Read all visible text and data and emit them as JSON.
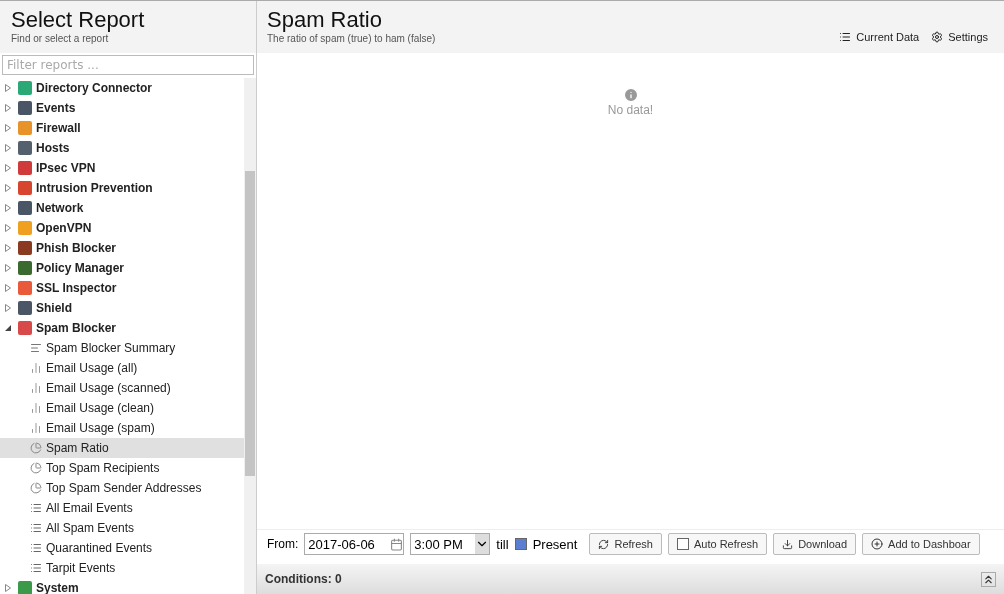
{
  "sidebar": {
    "title": "Select Report",
    "subtitle": "Find or select a report",
    "filter": {
      "placeholder": "Filter reports ..."
    },
    "tree": [
      {
        "label": "Directory Connector",
        "color": "#2aa876",
        "expanded": false
      },
      {
        "label": "Events",
        "color": "#4a5566",
        "expanded": false
      },
      {
        "label": "Firewall",
        "color": "#e8932a",
        "expanded": false
      },
      {
        "label": "Hosts",
        "color": "#55606e",
        "expanded": false
      },
      {
        "label": "IPsec VPN",
        "color": "#d03a3a",
        "expanded": false
      },
      {
        "label": "Intrusion Prevention",
        "color": "#d8452e",
        "expanded": false
      },
      {
        "label": "Network",
        "color": "#4a5566",
        "expanded": false
      },
      {
        "label": "OpenVPN",
        "color": "#f0a020",
        "expanded": false
      },
      {
        "label": "Phish Blocker",
        "color": "#8a3a20",
        "expanded": false
      },
      {
        "label": "Policy Manager",
        "color": "#3a6a30",
        "expanded": false
      },
      {
        "label": "SSL Inspector",
        "color": "#e85a3a",
        "expanded": false
      },
      {
        "label": "Shield",
        "color": "#4a5566",
        "expanded": false
      },
      {
        "label": "Spam Blocker",
        "color": "#d84a4a",
        "expanded": true,
        "children": [
          {
            "label": "Spam Blocker Summary",
            "kind": "text",
            "selected": false
          },
          {
            "label": "Email Usage (all)",
            "kind": "bar",
            "selected": false
          },
          {
            "label": "Email Usage (scanned)",
            "kind": "bar",
            "selected": false
          },
          {
            "label": "Email Usage (clean)",
            "kind": "bar",
            "selected": false
          },
          {
            "label": "Email Usage (spam)",
            "kind": "bar",
            "selected": false
          },
          {
            "label": "Spam Ratio",
            "kind": "pie",
            "selected": true
          },
          {
            "label": "Top Spam Recipients",
            "kind": "pie",
            "selected": false
          },
          {
            "label": "Top Spam Sender Addresses",
            "kind": "pie",
            "selected": false
          },
          {
            "label": "All Email Events",
            "kind": "list",
            "selected": false
          },
          {
            "label": "All Spam Events",
            "kind": "list",
            "selected": false
          },
          {
            "label": "Quarantined Events",
            "kind": "list",
            "selected": false
          },
          {
            "label": "Tarpit Events",
            "kind": "list",
            "selected": false
          }
        ]
      },
      {
        "label": "System",
        "color": "#3a9a4a",
        "expanded": false
      }
    ]
  },
  "report": {
    "title": "Spam Ratio",
    "subtitle": "The ratio of spam (true) to ham (false)",
    "actions": [
      {
        "label": "Current Data",
        "kind": "data"
      },
      {
        "label": "Settings",
        "kind": "settings"
      }
    ],
    "message": "No data!",
    "toolbar": {
      "from_label": "From:",
      "date": "2017-06-06",
      "time": "3:00 PM",
      "till_label": "till",
      "present": {
        "label": "Present",
        "checked": true
      },
      "buttons": [
        {
          "label": "Refresh",
          "kind": "refresh"
        },
        {
          "label": "Auto Refresh",
          "kind": "check",
          "checked": false
        },
        {
          "label": "Download",
          "kind": "download"
        },
        {
          "label": "Add to Dashboar",
          "kind": "add"
        }
      ]
    },
    "conditions": "Conditions: 0"
  }
}
